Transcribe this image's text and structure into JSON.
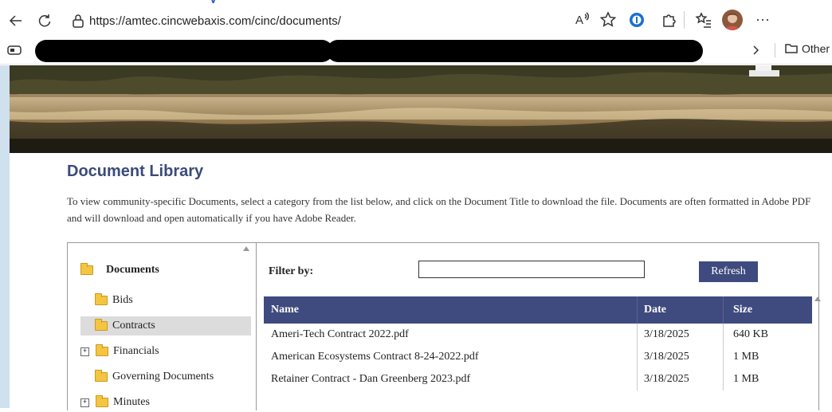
{
  "browser": {
    "url": "https://amtec.cincwebaxis.com/cinc/documents/",
    "overflow_text": "Other",
    "top_strip_text": "y"
  },
  "page": {
    "title": "Document Library",
    "intro": "To view community-specific Documents, select a category from the list below, and click on the Document Title to download the file.  Documents are often formatted in Adobe PDF and will download and open automatically if you have Adobe Reader."
  },
  "tree": {
    "root": "Documents",
    "items": [
      {
        "label": "Bids",
        "expandable": false,
        "selected": false
      },
      {
        "label": "Contracts",
        "expandable": false,
        "selected": true
      },
      {
        "label": "Financials",
        "expandable": true,
        "selected": false
      },
      {
        "label": "Governing Documents",
        "expandable": false,
        "selected": false
      },
      {
        "label": "Minutes",
        "expandable": true,
        "selected": false
      }
    ],
    "expand_symbol": "+"
  },
  "filter": {
    "label": "Filter by:",
    "value": "",
    "refresh_label": "Refresh"
  },
  "table": {
    "columns": [
      "Name",
      "Date",
      "Size"
    ],
    "rows": [
      {
        "name": "Ameri-Tech Contract 2022.pdf",
        "date": "3/18/2025",
        "size": "640 KB"
      },
      {
        "name": "American Ecosystems Contract 8-24-2022.pdf",
        "date": "3/18/2025",
        "size": "1 MB"
      },
      {
        "name": "Retainer Contract - Dan Greenberg 2023.pdf",
        "date": "3/18/2025",
        "size": "1 MB"
      }
    ]
  },
  "colors": {
    "accent": "#3f4a7e",
    "title": "#3b4a7a",
    "folder": "#f5c542"
  },
  "icons": [
    "back-icon",
    "refresh-icon",
    "lock-icon",
    "read-aloud-icon",
    "favorite-icon",
    "password-manager-icon",
    "extensions-icon",
    "favorites-bar-icon",
    "profile-avatar",
    "more-icon",
    "sidebar-icon",
    "folder-icon"
  ]
}
